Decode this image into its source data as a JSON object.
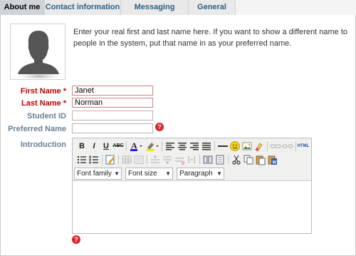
{
  "tabs": [
    {
      "label": "About me"
    },
    {
      "label": "Contact information"
    },
    {
      "label": "Messaging"
    },
    {
      "label": "General"
    }
  ],
  "intro_text": "Enter your real first and last name here. If you want to show a different name to people in the system, put that name in as your preferred name.",
  "form": {
    "first_name": {
      "label": "First Name",
      "required_mark": "*",
      "value": "Janet"
    },
    "last_name": {
      "label": "Last Name",
      "required_mark": "*",
      "value": "Norman"
    },
    "student_id": {
      "label": "Student ID",
      "value": ""
    },
    "preferred_name": {
      "label": "Preferred Name",
      "value": ""
    },
    "introduction": {
      "label": "Introduction"
    }
  },
  "editor": {
    "font_family": "Font family",
    "font_size": "Font size",
    "format": "Paragraph",
    "buttons": {
      "bold": "B",
      "italic": "I",
      "underline": "U",
      "strike": "ABC",
      "html": "HTML"
    }
  },
  "help_icon": "?",
  "colors": {
    "required": "#c00000",
    "label": "#6b7f90",
    "tab_text": "#2c5f85",
    "help": "#d8262b"
  }
}
